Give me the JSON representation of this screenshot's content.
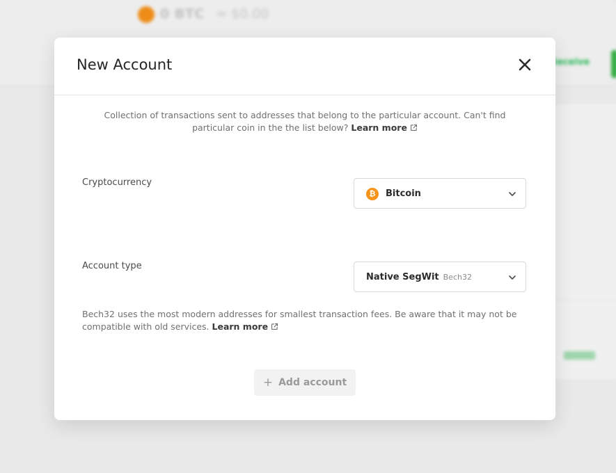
{
  "background": {
    "balance": "0 BTC",
    "fiat": "≈ $0.00",
    "receive_button": "Receive"
  },
  "modal": {
    "title": "New Account",
    "description": "Collection of transactions sent to addresses that belong to the particular account. Can't find particular coin in the the list below?",
    "learn_more": "Learn more",
    "cryptocurrency": {
      "label": "Cryptocurrency",
      "selected": "Bitcoin",
      "icon": "bitcoin-icon",
      "icon_glyph": "₿"
    },
    "account_type": {
      "label": "Account type",
      "selected": "Native SegWit",
      "sub": "Bech32",
      "description": "Bech32 uses the most modern addresses for smallest transaction fees. Be aware that it may not be compatible with old services.",
      "learn_more": "Learn more"
    },
    "add_button": {
      "label": "Add account",
      "icon": "+"
    }
  },
  "colors": {
    "bitcoin": "#f7931a",
    "accent_green": "#39b54a",
    "disabled_button_bg": "#f2f2f2",
    "disabled_button_text": "#9a9a9a"
  }
}
